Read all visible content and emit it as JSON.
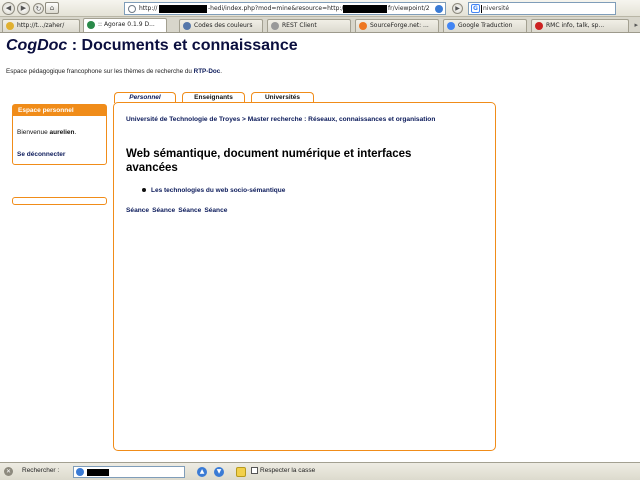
{
  "browser": {
    "url_parts": [
      "http://",
      "-hedi/index.php?mod=mine&resource=http://",
      "fr/viewpoint/2"
    ],
    "search_value": "niversité",
    "tabs": [
      {
        "label": "http://t.../zaher/",
        "color": "#e0b030",
        "active": false
      },
      {
        "label": ":: Agorae 0.1.9 D...",
        "color": "#2a8a4a",
        "active": true
      },
      {
        "label": "Codes des couleurs",
        "color": "#5577aa",
        "active": false
      },
      {
        "label": "REST Client",
        "color": "#999999",
        "active": false
      },
      {
        "label": "SourceForge.net: ...",
        "color": "#ee7722",
        "active": false
      },
      {
        "label": "Google Traduction",
        "color": "#4285f4",
        "active": false
      },
      {
        "label": "RMC info, talk, sp...",
        "color": "#cc2222",
        "active": false
      }
    ]
  },
  "header": {
    "brand": "CogDoc",
    "title_rest": " : Documents et connaissance",
    "tagline_prefix": "Espace pédagogique francophone sur les thèmes de recherche du ",
    "tagline_link": "RTP-Doc",
    "tagline_suffix": "."
  },
  "sidebar": {
    "heading": "Espace personnel",
    "welcome_prefix": "Bienvenue ",
    "username": "aurelien",
    "welcome_suffix": ".",
    "logout_label": "Se déconnecter"
  },
  "tabs": {
    "personnel": "Personnel",
    "enseignants": "Enseignants",
    "universites": "Universités"
  },
  "main": {
    "breadcrumb": "Université de Technologie de Troyes > Master recherche : Réseaux, connaissances et organisation",
    "course_title": "Web sémantique, document numérique et interfaces avancées",
    "resources": [
      "Les technologies du web socio-sémantique"
    ],
    "seances": [
      "Séance",
      "Séance",
      "Séance",
      "Séance"
    ]
  },
  "findbar": {
    "label": "Rechercher :",
    "match_case_label": "Respecter la casse"
  }
}
